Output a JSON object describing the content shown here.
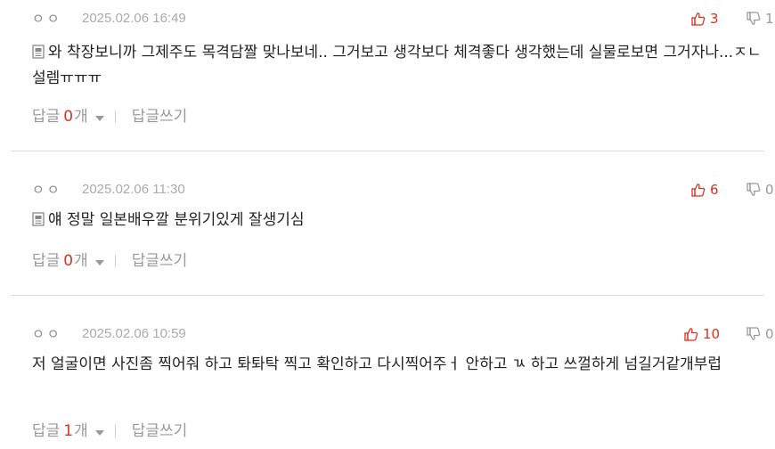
{
  "comments": [
    {
      "author": "ㅇㅇ",
      "date": "2025.02.06 16:49",
      "text": "와 착장보니까 그제주도 목격담짤 맞나보네.. 그거보고 생각보다 체격좋다 생각했는데 실물로보면 그거자나...ㅈㄴ설렘ㅠㅠㅠ",
      "likes": "3",
      "dislikes": "1",
      "reply_label": "답글",
      "reply_count": "0",
      "reply_unit": "개",
      "write_reply": "답글쓰기"
    },
    {
      "author": "ㅇㅇ",
      "date": "2025.02.06 11:30",
      "text": "얘 정말 일본배우깔 분위기있게 잘생기심",
      "likes": "6",
      "dislikes": "0",
      "reply_label": "답글",
      "reply_count": "0",
      "reply_unit": "개",
      "write_reply": "답글쓰기"
    },
    {
      "author": "ㅇㅇ",
      "date": "2025.02.06 10:59",
      "text": "저 얼굴이면 사진좀 찍어줘 하고 톼톼탁 찍고 확인하고 다시찍어주ㅓ 안하고 ㄳ 하고 쓰껄하게 넘길거같개부럽",
      "likes": "10",
      "dislikes": "0",
      "reply_label": "답글",
      "reply_count": "1",
      "reply_unit": "개",
      "write_reply": "답글쓰기"
    }
  ],
  "icons": {
    "like": "thumbs-up-icon",
    "dislike": "thumbs-down-icon",
    "document": "document-icon",
    "caret": "caret-down-icon"
  },
  "colors": {
    "accent_red": "#e0301e",
    "muted_gray": "#999999",
    "date_gray": "#aaaaaa",
    "text_dark": "#222222",
    "divider": "#dcdcdc"
  }
}
